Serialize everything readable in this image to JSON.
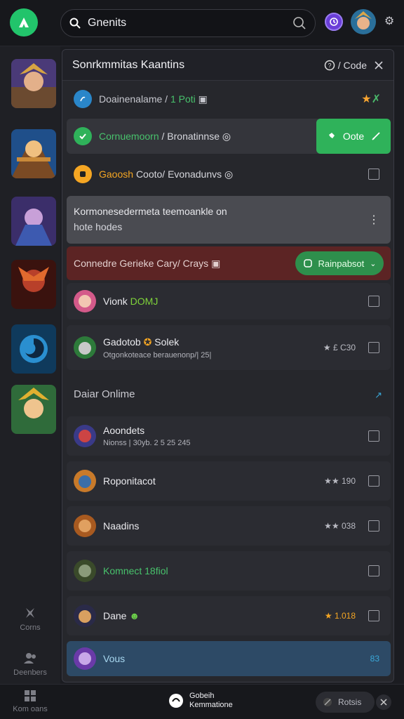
{
  "search": {
    "value": "Gnenits"
  },
  "sidebar": {
    "nav": [
      {
        "label": "Corns"
      },
      {
        "label": "Deenbers"
      },
      {
        "label": "Kom oans"
      }
    ]
  },
  "panel": {
    "title": "Sonrkmmitas Kaantins",
    "code_label": "/ Code",
    "rows": [
      {
        "name_main": "Doainenalame / ",
        "name_accent": "1 Poti",
        "name_icon": "▣"
      },
      {
        "name_main": "Cornuemoorn",
        "name_rest": "/ Bronatinnse",
        "name_icon": "◎",
        "action": "Oote"
      },
      {
        "name_accent": "Gaoosh",
        "name_main": "Cooto/ Evonadunvs",
        "name_icon": "◎"
      },
      {
        "line1": "Kormonesedermeta teemoankle on",
        "line2": "hote hodes"
      },
      {
        "name_main": "Connedre Gerieke Cary/ Crays",
        "name_icon": "▣",
        "action": "Rainpabsot"
      },
      {
        "name_main": "Vionk",
        "name_accent": "DOMJ"
      },
      {
        "name_main": "Gadotob",
        "name_rest": "Solek",
        "sub": "Otgonkoteace berauenonp/| 25|",
        "meta": "★ £ C30"
      }
    ],
    "section_label": "Daiar Onlime",
    "online": [
      {
        "name": "Aoondets",
        "sub": "Nionss | 30yb. 2 5 25 245"
      },
      {
        "name": "Roponitacot",
        "meta": "★★ 190"
      },
      {
        "name": "Naadins",
        "meta": "★★ 038"
      },
      {
        "name": "Komnect 18fiol"
      },
      {
        "name": "Dane",
        "meta": "★ 1.018"
      },
      {
        "name": "Vous",
        "meta": "83"
      }
    ]
  },
  "bottombar": {
    "center_line1": "Gobeih",
    "center_line2": "Kemmatione",
    "right_label": "Rotsis"
  },
  "colors": {
    "accent_green": "#2fb25a",
    "brand_green": "#22c46b",
    "alert_red": "#5c2424",
    "orange": "#f5a623"
  }
}
